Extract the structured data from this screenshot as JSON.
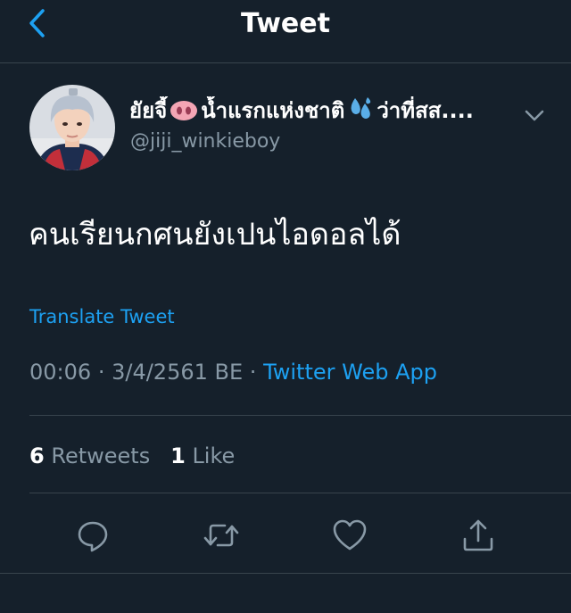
{
  "header": {
    "title": "Tweet"
  },
  "tweet": {
    "author_name_prefix": "ยัยจี้",
    "author_name_middle": "น้ำแรกแห่งชาติ",
    "author_name_suffix": "ว่าที่สส....",
    "handle": "@jiji_winkieboy",
    "text": "คนเรียนกศนยังเปนไอดอลได้",
    "translate_label": "Translate Tweet",
    "time": "00:06",
    "date": "3/4/2561 BE",
    "separator": "·",
    "source": "Twitter Web App",
    "retweets_count": "6",
    "retweets_label": "Retweets",
    "likes_count": "1",
    "likes_label": "Like"
  },
  "colors": {
    "background": "#15202b",
    "divider": "#38444d",
    "accent": "#1da1f2",
    "secondary_text": "#8899a6"
  },
  "icons": {
    "back": "chevron-left-icon",
    "more": "chevron-down-icon",
    "reply": "reply-icon",
    "retweet": "retweet-icon",
    "like": "heart-icon",
    "share": "share-icon",
    "name_emoji_1": "pig-nose-emoji",
    "name_emoji_2": "sweat-droplets-emoji"
  }
}
